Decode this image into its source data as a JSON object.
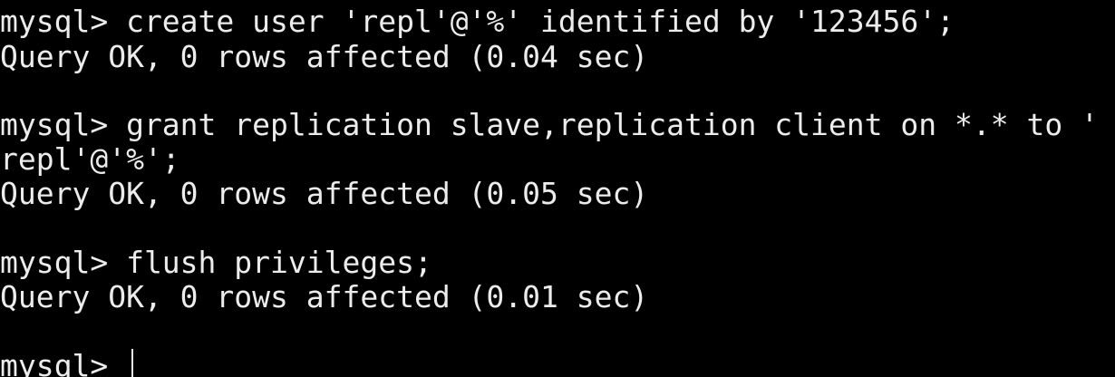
{
  "terminal": {
    "lines": [
      "mysql> create user 'repl'@'%' identified by '123456';",
      "Query OK, 0 rows affected (0.04 sec)",
      "",
      "mysql> grant replication slave,replication client on *.* to '",
      "repl'@'%';",
      "Query OK, 0 rows affected (0.05 sec)",
      "",
      "mysql> flush privileges;",
      "Query OK, 0 rows affected (0.01 sec)",
      "",
      "mysql> "
    ],
    "colors": {
      "background": "#000000",
      "text": "#ececec"
    }
  }
}
